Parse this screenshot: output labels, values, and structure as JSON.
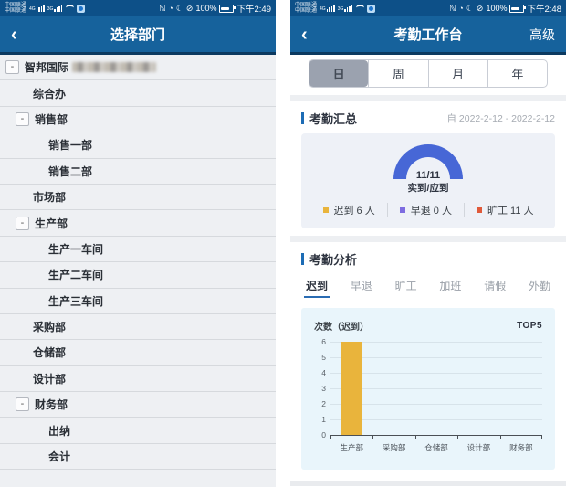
{
  "colors": {
    "statusbar": "#0d5088",
    "header": "#16629c",
    "header_border": "#0c3a60",
    "accent_blue": "#1d6cb5",
    "gauge_blue": "#4767d6",
    "bar_yellow": "#e9b43c",
    "legend_purple": "#7d6ce0",
    "legend_red": "#e05a3a",
    "summary_card_bg": "#eef1f7",
    "chart_card_bg": "#e9f5fb",
    "selected_segment_bg": "#9ba2af",
    "list_bg": "#eef0f3"
  },
  "status_icons": {
    "nfc": "ℕ",
    "alarm": "◔",
    "moon": "☾",
    "mute": "⊘"
  },
  "left_screen": {
    "status_bar": {
      "carrier1": "中国联通",
      "carrier2": "中国联通",
      "sim1_net": "4G",
      "sim2_net": "3G",
      "battery": "100%",
      "time": "下午2:49"
    },
    "header": {
      "back": "‹",
      "title": "选择部门"
    },
    "tree": {
      "collapse_glyph": "-",
      "rows": [
        {
          "label": "智邦国际",
          "level": 0,
          "expandable": true,
          "redacted": true
        },
        {
          "label": "综合办",
          "level": 1,
          "expandable": false
        },
        {
          "label": "销售部",
          "level": 1,
          "expandable": true
        },
        {
          "label": "销售一部",
          "level": 2,
          "expandable": false
        },
        {
          "label": "销售二部",
          "level": 2,
          "expandable": false
        },
        {
          "label": "市场部",
          "level": 1,
          "expandable": false
        },
        {
          "label": "生产部",
          "level": 1,
          "expandable": true
        },
        {
          "label": "生产一车间",
          "level": 2,
          "expandable": false
        },
        {
          "label": "生产二车间",
          "level": 2,
          "expandable": false
        },
        {
          "label": "生产三车间",
          "level": 2,
          "expandable": false
        },
        {
          "label": "采购部",
          "level": 1,
          "expandable": false
        },
        {
          "label": "仓储部",
          "level": 1,
          "expandable": false
        },
        {
          "label": "设计部",
          "level": 1,
          "expandable": false
        },
        {
          "label": "财务部",
          "level": 1,
          "expandable": true
        },
        {
          "label": "出纳",
          "level": 2,
          "expandable": false
        },
        {
          "label": "会计",
          "level": 2,
          "expandable": false
        }
      ]
    }
  },
  "right_screen": {
    "status_bar": {
      "carrier1": "中国联通",
      "carrier2": "中国联通",
      "sim1_net": "4G",
      "sim2_net": "3G",
      "battery": "100%",
      "time": "下午2:48"
    },
    "header": {
      "back": "‹",
      "title": "考勤工作台",
      "action": "高级"
    },
    "segments": {
      "items": [
        "日",
        "周",
        "月",
        "年"
      ],
      "selected_index": 0
    },
    "summary": {
      "title": "考勤汇总",
      "date_range": "自 2022-2-12 - 2022-2-12",
      "gauge_value": "11/11",
      "gauge_label": "实到/应到",
      "legend": [
        {
          "text": "迟到 6 人",
          "color": "#e9b43c"
        },
        {
          "text": "早退 0 人",
          "color": "#7d6ce0"
        },
        {
          "text": "旷工 11 人",
          "color": "#e05a3a"
        }
      ]
    },
    "analysis": {
      "title": "考勤分析",
      "tabs": [
        "迟到",
        "早退",
        "旷工",
        "加班",
        "请假",
        "外勤"
      ],
      "active_index": 0
    },
    "chart": {
      "title": "次数（迟到）",
      "badge": "TOP5"
    }
  },
  "chart_data": [
    {
      "type": "gauge",
      "title": "考勤汇总",
      "value_text": "11/11",
      "actual": 11,
      "expected": 11,
      "label": "实到/应到",
      "color": "#4767d6",
      "legend": [
        {
          "name": "迟到",
          "count": 6,
          "unit": "人",
          "color": "#e9b43c"
        },
        {
          "name": "早退",
          "count": 0,
          "unit": "人",
          "color": "#7d6ce0"
        },
        {
          "name": "旷工",
          "count": 11,
          "unit": "人",
          "color": "#e05a3a"
        }
      ]
    },
    {
      "type": "bar",
      "title": "次数（迟到）",
      "badge": "TOP5",
      "categories": [
        "生产部",
        "采购部",
        "仓储部",
        "设计部",
        "财务部"
      ],
      "values": [
        6,
        0,
        0,
        0,
        0
      ],
      "ylim": [
        0,
        6
      ],
      "yticks": [
        6,
        5,
        4,
        3,
        2,
        1,
        0
      ],
      "bar_color": "#e9b43c",
      "grid": true,
      "legend_position": "none"
    }
  ]
}
